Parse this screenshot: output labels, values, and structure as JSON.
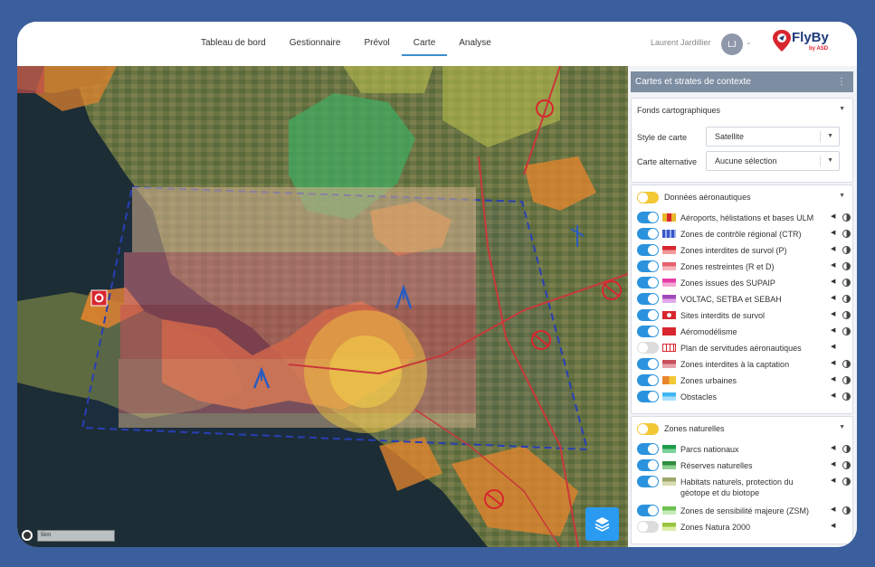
{
  "nav": {
    "items": [
      "Tableau de bord",
      "Gestionnaire",
      "Prévol",
      "Carte",
      "Analyse"
    ],
    "active": "Carte"
  },
  "user": {
    "name": "Laurent Jardillier",
    "initials": "LJ"
  },
  "logo": {
    "text": "FlyBy",
    "sub": "by ASD"
  },
  "map": {
    "scale_label": "5km"
  },
  "panel": {
    "title": "Cartes et strates de contexte",
    "basemaps": {
      "title": "Fonds cartographiques",
      "style_label": "Style de carte",
      "style_value": "Satellite",
      "alt_label": "Carte alternative",
      "alt_value": "Aucune sélection"
    },
    "aero": {
      "title": "Données aéronautiques",
      "layers": [
        {
          "label": "Aéroports, hélistations et bases ULM",
          "on": true
        },
        {
          "label": "Zones de contrôle régional (CTR)",
          "on": true
        },
        {
          "label": "Zones interdites de survol (P)",
          "on": true
        },
        {
          "label": "Zones restreintes (R et D)",
          "on": true
        },
        {
          "label": "Zones issues des SUPAIP",
          "on": true
        },
        {
          "label": "VOLTAC, SETBA et SEBAH",
          "on": true
        },
        {
          "label": "Sites interdits de survol",
          "on": true
        },
        {
          "label": "Aéromodélisme",
          "on": true
        },
        {
          "label": "Plan de servitudes aéronautiques",
          "on": false
        },
        {
          "label": "Zones interdites à la captation",
          "on": true
        },
        {
          "label": "Zones urbaines",
          "on": true
        },
        {
          "label": "Obstacles",
          "on": true
        }
      ]
    },
    "nature": {
      "title": "Zones naturelles",
      "layers": [
        {
          "label": "Parcs nationaux",
          "on": true
        },
        {
          "label": "Réserves naturelles",
          "on": true
        },
        {
          "label": "Habitats naturels, protection du géotope et du biotope",
          "on": true
        },
        {
          "label": "Zones de sensibilité majeure (ZSM)",
          "on": true
        },
        {
          "label": "Zones Natura 2000",
          "on": false
        }
      ]
    }
  },
  "colors": {
    "accent": "#2b93de",
    "frame": "#3b5e9c",
    "panel_header": "#7d8da2",
    "yellow_toggle": "#f3c835"
  }
}
